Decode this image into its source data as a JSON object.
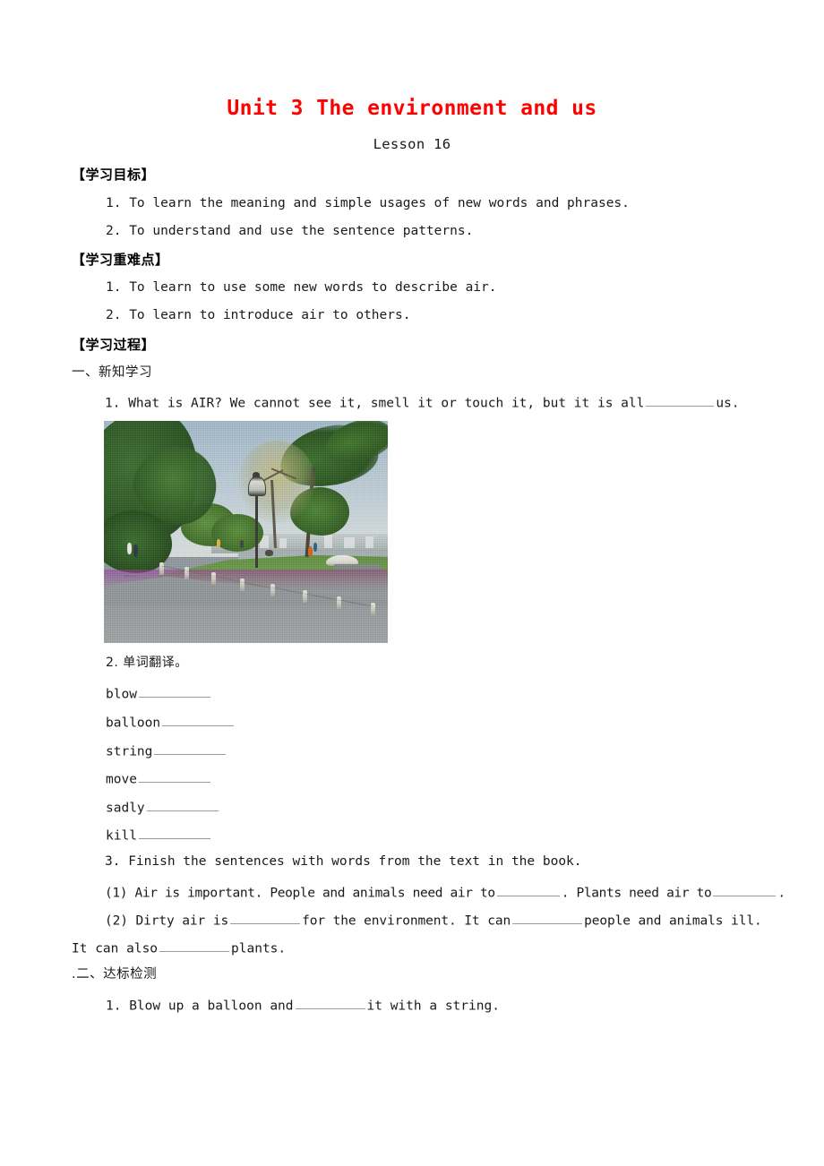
{
  "document": {
    "title": "Unit 3 The environment and us",
    "subtitle": "Lesson 16",
    "title_color": "#ff0000"
  },
  "sections": {
    "objectives": {
      "heading": "【学习目标】",
      "items": [
        "1. To learn the meaning and simple usages of new words and phrases.",
        "2. To understand and use the sentence patterns."
      ]
    },
    "key_points": {
      "heading": "【学习重难点】",
      "items": [
        "1. To learn to use some new words to describe air.",
        "2. To learn to introduce air to others."
      ]
    },
    "process": {
      "heading": "【学习过程】",
      "part_one_heading": "一、新知学习",
      "q1": {
        "before_blank": "1. What is AIR? We cannot see it, smell it or touch it, but it is all",
        "after_blank": "us."
      },
      "q2_heading": "2. 单词翻译。",
      "vocabulary": [
        "blow",
        "balloon",
        "string",
        "move",
        "sadly",
        "kill"
      ],
      "q3_heading": "3. Finish the sentences with words from the text in the book.",
      "q3_items": [
        {
          "part_a": "(1) Air is important. People and animals need air to",
          "part_b": ". Plants need air to",
          "part_c": "."
        },
        {
          "part_a": "(2) Dirty air is",
          "part_b": "for the environment. It can",
          "part_c": "people and animals ill.",
          "wrap_a": "It can also",
          "wrap_b": "plants."
        }
      ],
      "part_two_heading": ".二、达标检测",
      "test_q1": {
        "before_blank": "1. Blow up a balloon and",
        "after_blank": "it with a string."
      }
    }
  },
  "photo": {
    "alt": "windy park scene with road, trees, lamppost and lake"
  }
}
